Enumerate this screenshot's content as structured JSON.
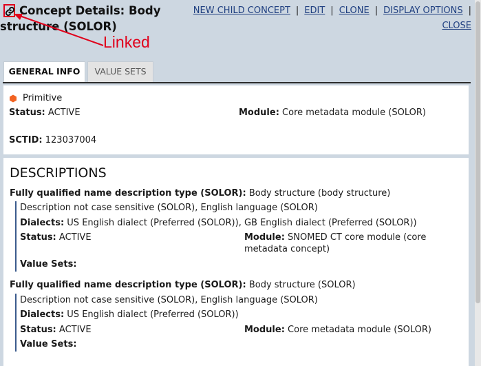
{
  "header": {
    "title": "Concept Details: Body structure (SOLOR)",
    "annotation_label": "Linked",
    "actions": [
      "NEW CHILD CONCEPT",
      "EDIT",
      "CLONE",
      "DISPLAY OPTIONS",
      "CLOSE"
    ],
    "separator": "|"
  },
  "tabs": [
    "GENERAL INFO",
    "VALUE SETS"
  ],
  "general_info": {
    "definition": "Primitive",
    "status_label": "Status:",
    "status_value": "ACTIVE",
    "module_label": "Module:",
    "module_value": "Core metadata module (SOLOR)",
    "sctid_label": "SCTID:",
    "sctid_value": "123037004"
  },
  "descriptions": {
    "title": "DESCRIPTIONS",
    "items": [
      {
        "type_label": "Fully qualified name description type (SOLOR):",
        "text": "Body structure (body structure)",
        "case_language": "Description not case sensitive (SOLOR), English language (SOLOR)",
        "dialects_label": "Dialects:",
        "dialects": "US English dialect (Preferred (SOLOR)), GB English dialect (Preferred (SOLOR))",
        "status_label": "Status:",
        "status": "ACTIVE",
        "module_label": "Module:",
        "module": "SNOMED CT core module (core metadata concept)",
        "value_sets_label": "Value Sets:"
      },
      {
        "type_label": "Fully qualified name description type (SOLOR):",
        "text": "Body structure (SOLOR)",
        "case_language": "Description not case sensitive (SOLOR), English language (SOLOR)",
        "dialects_label": "Dialects:",
        "dialects": "US English dialect (Preferred (SOLOR))",
        "status_label": "Status:",
        "status": "ACTIVE",
        "module_label": "Module:",
        "module": "Core metadata module (SOLOR)",
        "value_sets_label": "Value Sets:"
      }
    ]
  },
  "colors": {
    "header_bg": "#cdd7e1",
    "link": "#1f3f80",
    "annotation": "#e0001b",
    "primitive_marker": "#f26322"
  },
  "icons": {
    "link": "link-icon",
    "primitive": "hexagon-icon"
  }
}
